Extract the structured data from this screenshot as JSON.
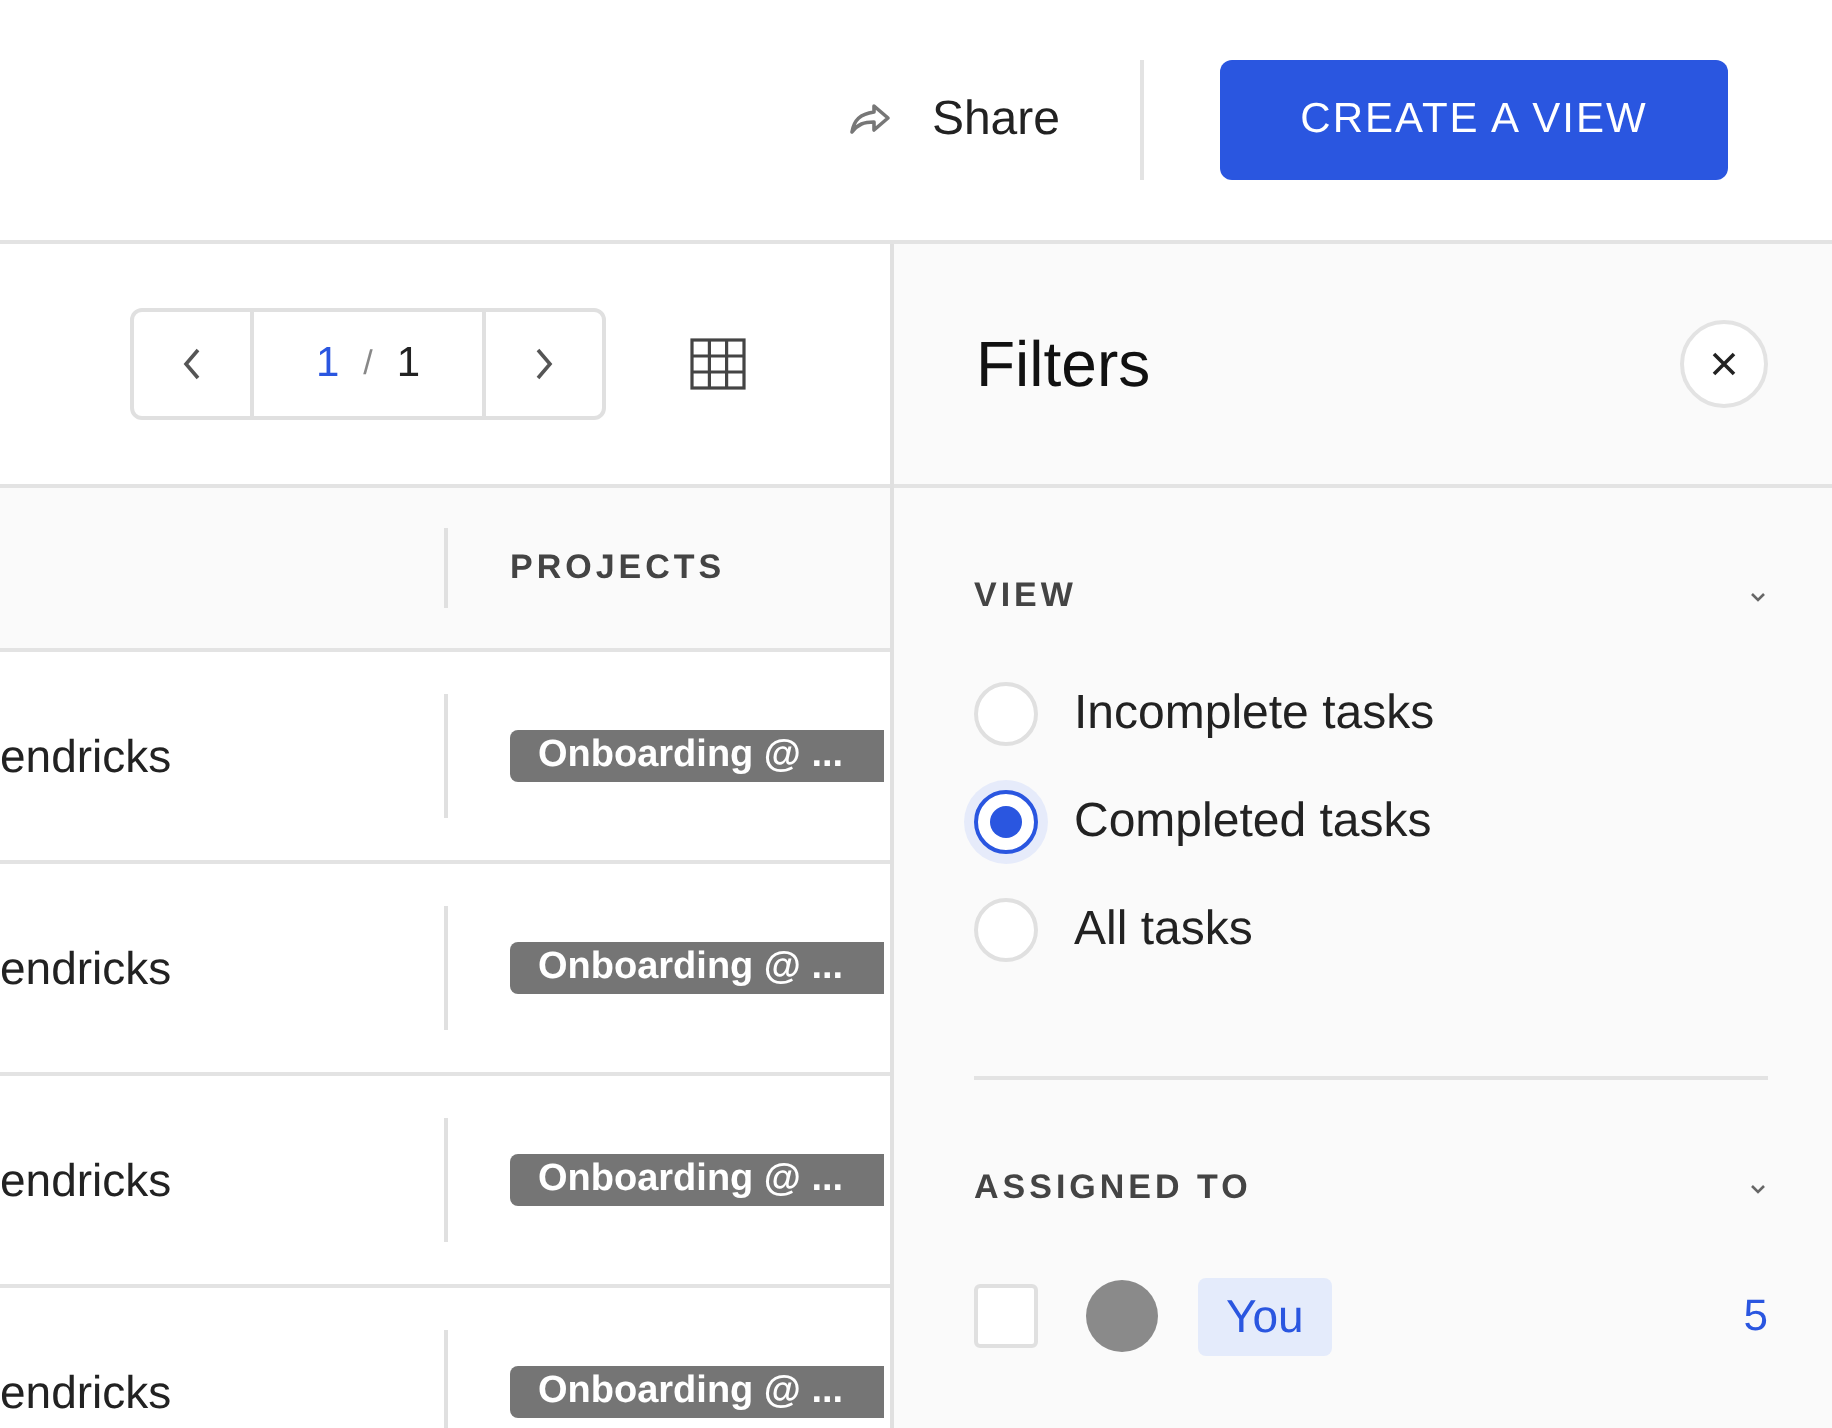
{
  "header": {
    "share_label": "Share",
    "create_button": "CREATE A VIEW"
  },
  "pagination": {
    "current": "1",
    "separator": "/",
    "total": "1"
  },
  "table": {
    "column_2_header": "PROJECTS",
    "rows": [
      {
        "column_1": "endricks",
        "project": "Onboarding @ ..."
      },
      {
        "column_1": "endricks",
        "project": "Onboarding @ ..."
      },
      {
        "column_1": "endricks",
        "project": "Onboarding @ ..."
      },
      {
        "column_1": "endricks",
        "project": "Onboarding @ ..."
      }
    ]
  },
  "filters": {
    "title": "Filters",
    "sections": [
      {
        "kind": "radio",
        "title": "VIEW",
        "expanded": true,
        "options": [
          {
            "label": "Incomplete tasks",
            "selected": false
          },
          {
            "label": "Completed tasks",
            "selected": true
          },
          {
            "label": "All tasks",
            "selected": false
          }
        ]
      },
      {
        "kind": "checkbox",
        "title": "ASSIGNED TO",
        "expanded": true,
        "options": [
          {
            "label": "You",
            "count": "5",
            "checked": false
          }
        ]
      }
    ]
  }
}
